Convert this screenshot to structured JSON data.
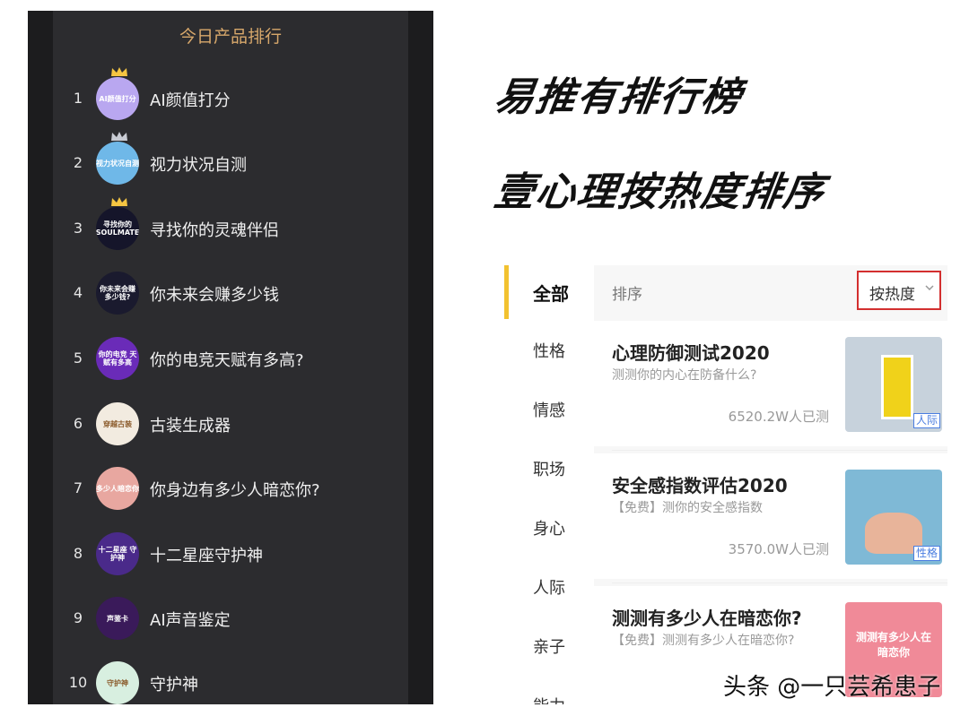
{
  "ranking": {
    "title": "今日产品排行",
    "items": [
      {
        "rank": "1",
        "name": "AI颜值打分",
        "avatar_text": "AI颜值打分",
        "avatar_color": "#b9a7f0",
        "crown": "gold"
      },
      {
        "rank": "2",
        "name": "视力状况自测",
        "avatar_text": "视力状况自测",
        "avatar_color": "#6fb8e8",
        "crown": "silver"
      },
      {
        "rank": "3",
        "name": "寻找你的灵魂伴侣",
        "avatar_text": "寻找你的 SOULMATE",
        "avatar_color": "#15152a",
        "crown": "gold"
      },
      {
        "rank": "4",
        "name": "你未来会赚多少钱",
        "avatar_text": "你未来会赚 多少钱?",
        "avatar_color": "#1a1a2e",
        "crown": ""
      },
      {
        "rank": "5",
        "name": "你的电竞天赋有多高?",
        "avatar_text": "你的电竞 天赋有多高",
        "avatar_color": "#6a2bb8",
        "crown": ""
      },
      {
        "rank": "6",
        "name": "古装生成器",
        "avatar_text": "穿越古装",
        "avatar_color": "#f2ebe0",
        "crown": ""
      },
      {
        "rank": "7",
        "name": "你身边有多少人暗恋你?",
        "avatar_text": "多少人暗恋你",
        "avatar_color": "#e8a7a0",
        "crown": ""
      },
      {
        "rank": "8",
        "name": "十二星座守护神",
        "avatar_text": "十二星座 守护神",
        "avatar_color": "#4a2a8a",
        "crown": ""
      },
      {
        "rank": "9",
        "name": "AI声音鉴定",
        "avatar_text": "声鉴卡",
        "avatar_color": "#3a1a5a",
        "crown": ""
      },
      {
        "rank": "10",
        "name": "守护神",
        "avatar_text": "守护神",
        "avatar_color": "#d8efe0",
        "crown": ""
      }
    ]
  },
  "headlines": {
    "line1": "易推有排行榜",
    "line2": "壹心理按热度排序"
  },
  "app": {
    "categories": [
      "全部",
      "性格",
      "情感",
      "职场",
      "身心",
      "人际",
      "亲子",
      "能力"
    ],
    "sort_label": "排序",
    "sort_button": "按热度",
    "cards": [
      {
        "title": "心理防御测试2020",
        "subtitle": "测测你的内心在防备什么?",
        "count": "6520.2W人已测",
        "tag": "人际",
        "thumb_color": "#c7d2dc"
      },
      {
        "title": "安全感指数评估2020",
        "subtitle": "【免费】测你的安全感指数",
        "count": "3570.0W人已测",
        "tag": "性格",
        "thumb_color": "#7fb9d6"
      },
      {
        "title": "测测有多少人在暗恋你?",
        "subtitle": "【免费】测测有多少人在暗恋你?",
        "count": "",
        "tag": "",
        "thumb_color": "#f08a98",
        "thumb_text": "测测有多少人在暗恋你"
      }
    ]
  },
  "watermark": "头条 @一只芸希患子",
  "colors": {
    "accent": "#f2c230",
    "title_gold": "#d8a86b",
    "highlight_border": "#d32f2f",
    "tag_blue": "#4a7de0"
  }
}
